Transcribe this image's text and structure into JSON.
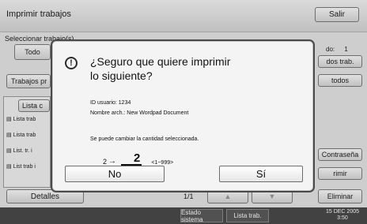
{
  "header": {
    "title": "Imprimir trabajos",
    "exit_label": "Salir"
  },
  "background": {
    "instruction": "Seleccionar trabajo(s).",
    "left_tab_visible": "Todo",
    "jobs_left_visible": "Trabajos pr",
    "list_header_visible": "Lista c",
    "list_items_visible": [
      "Lista trab",
      "Lista trab",
      "List. tr. i",
      "List trab i"
    ],
    "details_label": "Detalles",
    "page_indicator": "1/1",
    "right_count_label": "do:",
    "right_count_value": "1",
    "right_btn_jobs": "dos trab.",
    "right_btn_all": "todos",
    "right_btn_password": "Contraseña",
    "right_btn_print": "rimir",
    "delete_label": "Eliminar"
  },
  "dialog": {
    "title_line1": "¿Seguro que quiere imprimir",
    "title_line2": "lo siguiente?",
    "user_id": "ID usuario: 1234",
    "file_name": "Nombre arch.: New Wordpad Document",
    "change_qty_note": "Se puede cambiar la cantidad seleccionada.",
    "qty_from": "2",
    "qty_arrow": "→",
    "qty_to": "2",
    "qty_range": "<1~999>",
    "no_label": "No",
    "yes_label": "Sí"
  },
  "taskbar": {
    "system_status_label": "Estado sistema",
    "job_list_label": "Lista trab.",
    "date": "15 DEC 2005",
    "time": "3:50"
  },
  "colors": {
    "dialog_border": "#4a4a4a",
    "taskbar": "#4a4a4a",
    "background": "#e6e6e6"
  }
}
